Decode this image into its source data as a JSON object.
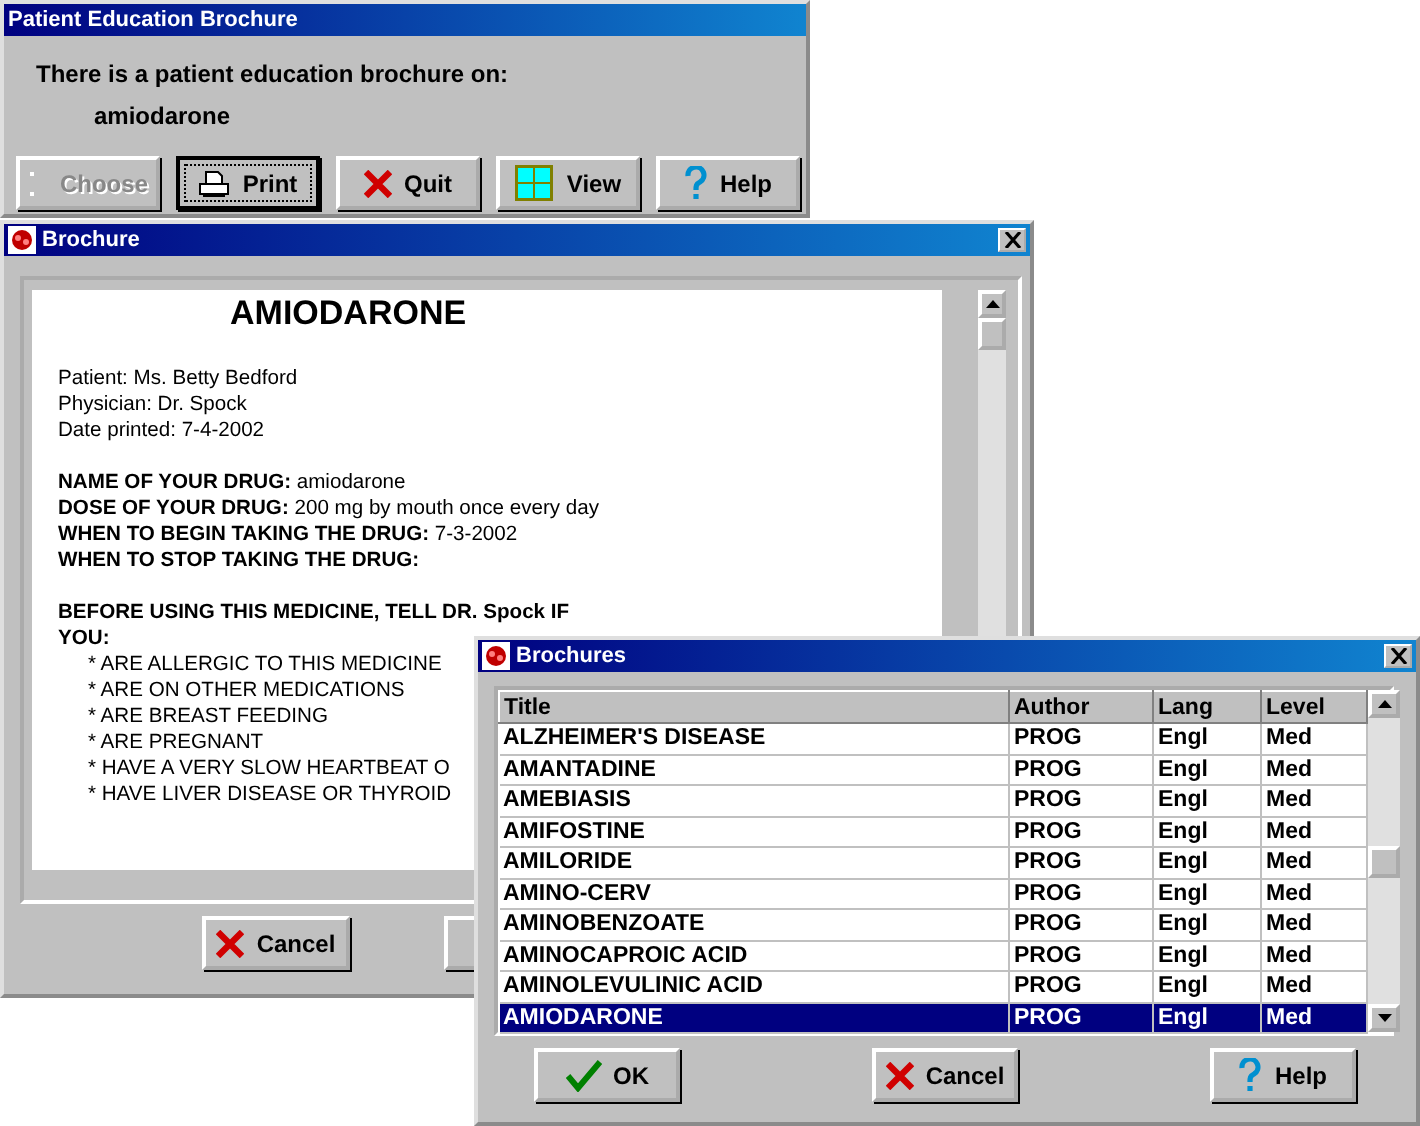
{
  "prompt_window": {
    "title": "Patient Education Brochure",
    "message": "There is a patient education brochure on:",
    "drug": "amiodarone",
    "buttons": [
      {
        "label": "Choose",
        "disabled": true,
        "focused": false
      },
      {
        "label": "Print",
        "disabled": false,
        "focused": true
      },
      {
        "label": "Quit",
        "disabled": false,
        "focused": false
      },
      {
        "label": "View",
        "disabled": false,
        "focused": false
      },
      {
        "label": "Help",
        "disabled": false,
        "focused": false
      }
    ]
  },
  "brochure_window": {
    "title": "Brochure",
    "document": {
      "heading": "AMIODARONE",
      "blocks": [
        {
          "lines": [
            {
              "kind": "plain",
              "text": "Patient: Ms. Betty Bedford"
            },
            {
              "kind": "plain",
              "text": "Physician: Dr. Spock"
            },
            {
              "kind": "plain",
              "text": "Date printed: 7-4-2002"
            }
          ]
        },
        {
          "lines": [
            {
              "kind": "plain",
              "text": "**NAME OF YOUR DRUG:** amiodarone"
            },
            {
              "kind": "plain",
              "text": "**DOSE OF YOUR DRUG:**  200 mg by mouth once every day"
            },
            {
              "kind": "plain",
              "text": "**WHEN TO BEGIN TAKING THE DRUG:** 7-3-2002"
            },
            {
              "kind": "bold",
              "text": "WHEN TO STOP TAKING THE DRUG:"
            }
          ]
        },
        {
          "lines": [
            {
              "kind": "bold",
              "text": "BEFORE USING THIS MEDICINE, TELL DR. Spock IF YOU:"
            },
            {
              "kind": "bullet",
              "text": "* ARE ALLERGIC TO THIS MEDICINE"
            },
            {
              "kind": "bullet",
              "text": "* ARE ON OTHER MEDICATIONS"
            },
            {
              "kind": "bullet",
              "text": "* ARE BREAST FEEDING"
            },
            {
              "kind": "bullet",
              "text": "* ARE PREGNANT"
            },
            {
              "kind": "bullet",
              "text": "* HAVE A VERY SLOW HEARTBEAT O"
            },
            {
              "kind": "bullet",
              "text": "* HAVE LIVER DISEASE OR THYROID"
            }
          ]
        }
      ]
    },
    "buttons": [
      {
        "label": "Cancel"
      }
    ]
  },
  "brochures_window": {
    "title": "Brochures",
    "table": {
      "columns": [
        "Title",
        "Author",
        "Lang",
        "Level"
      ],
      "rows": [
        {
          "cells": [
            "ALZHEIMER'S DISEASE",
            "PROG",
            "Engl",
            "Med"
          ],
          "selected": false
        },
        {
          "cells": [
            "AMANTADINE",
            "PROG",
            "Engl",
            "Med"
          ],
          "selected": false
        },
        {
          "cells": [
            "AMEBIASIS",
            "PROG",
            "Engl",
            "Med"
          ],
          "selected": false
        },
        {
          "cells": [
            "AMIFOSTINE",
            "PROG",
            "Engl",
            "Med"
          ],
          "selected": false
        },
        {
          "cells": [
            "AMILORIDE",
            "PROG",
            "Engl",
            "Med"
          ],
          "selected": false
        },
        {
          "cells": [
            "AMINO-CERV",
            "PROG",
            "Engl",
            "Med"
          ],
          "selected": false
        },
        {
          "cells": [
            "AMINOBENZOATE",
            "PROG",
            "Engl",
            "Med"
          ],
          "selected": false
        },
        {
          "cells": [
            "AMINOCAPROIC ACID",
            "PROG",
            "Engl",
            "Med"
          ],
          "selected": false
        },
        {
          "cells": [
            "AMINOLEVULINIC ACID",
            "PROG",
            "Engl",
            "Med"
          ],
          "selected": false
        },
        {
          "cells": [
            "AMIODARONE",
            "PROG",
            "Engl",
            "Med"
          ],
          "selected": true
        }
      ]
    },
    "buttons": [
      {
        "label": "OK"
      },
      {
        "label": "Cancel"
      },
      {
        "label": "Help"
      }
    ]
  }
}
